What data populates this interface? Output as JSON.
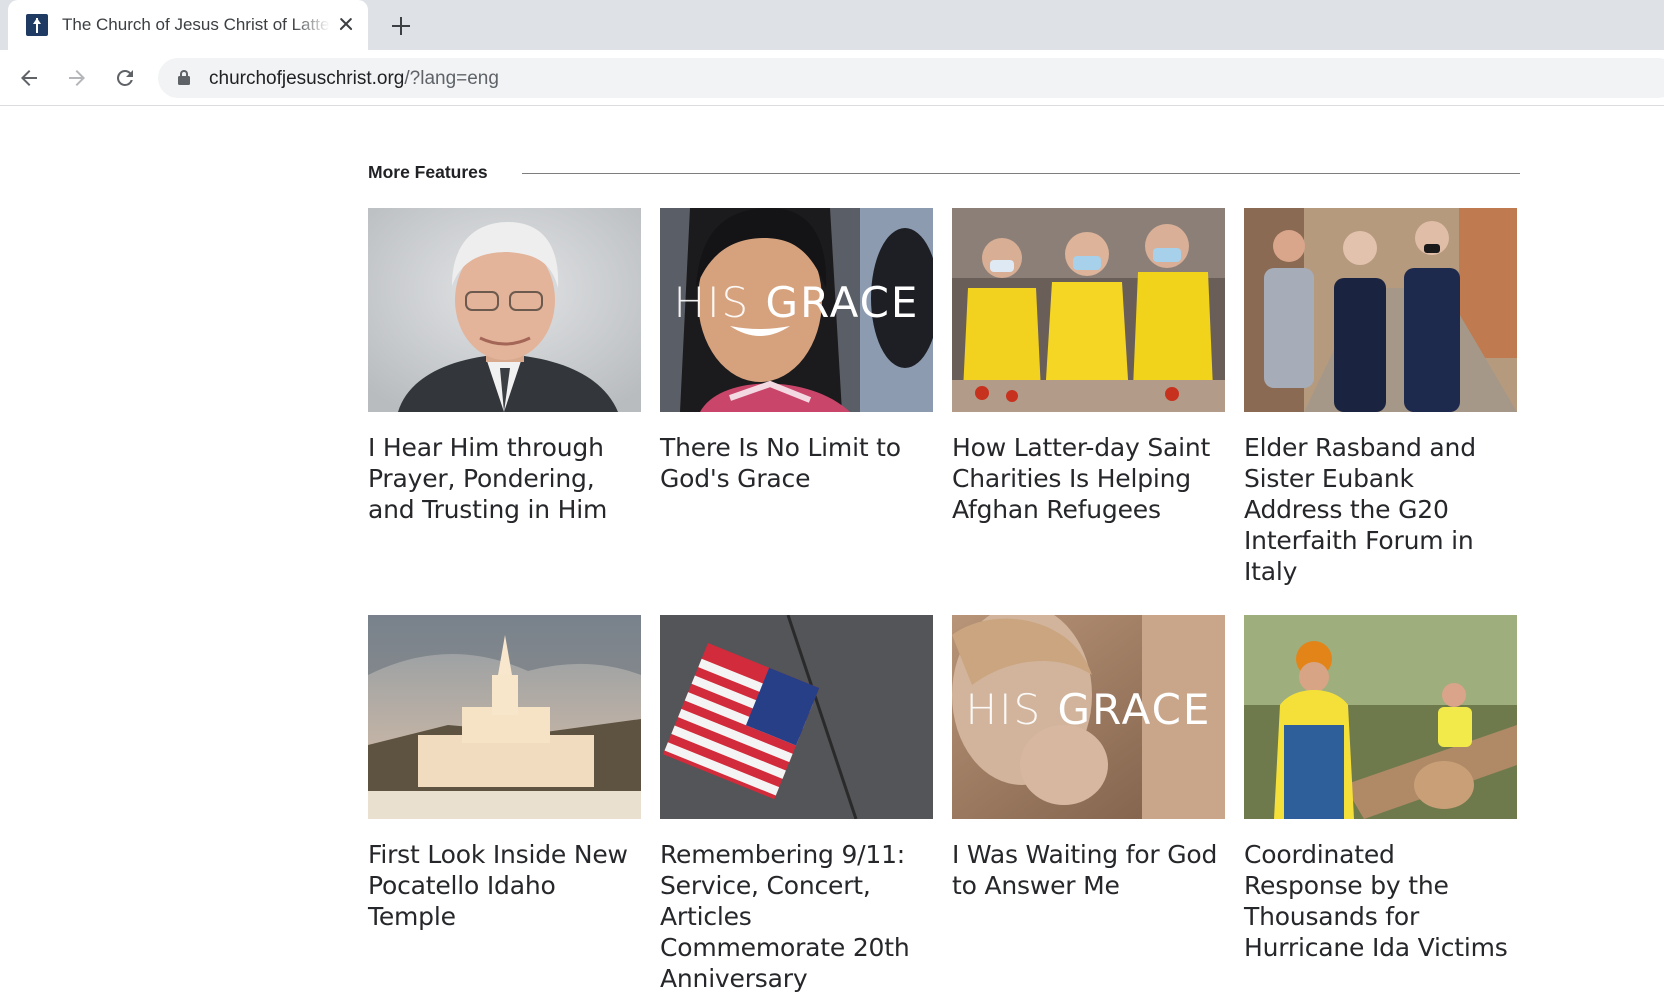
{
  "browser": {
    "tab": {
      "title": "The Church of Jesus Christ of Latter-day Saints",
      "favicon": "church-logo-icon"
    },
    "new_tab_icon": "plus-icon",
    "address_bar": {
      "host": "churchofjesuschrist.org",
      "path": "/?lang=eng"
    },
    "icons": [
      "back-arrow-icon",
      "forward-arrow-icon",
      "reload-icon",
      "lock-icon",
      "close-icon"
    ]
  },
  "section": {
    "title": "More Features",
    "cards": [
      {
        "title": "I Hear Him through Prayer, Pondering, and Trusting in Him"
      },
      {
        "title": "There Is No Limit to God's Grace",
        "overlay": {
          "his": "HIS",
          "grace": "GRACE"
        }
      },
      {
        "title": "How Latter-day Saint Charities Is Helping Afghan Refugees"
      },
      {
        "title": "Elder Rasband and Sister Eubank Address the G20 Interfaith Forum in Italy"
      },
      {
        "title": "First Look Inside New Pocatello Idaho Temple"
      },
      {
        "title": "Remembering 9/11: Service, Concert, Articles Commemorate 20th Anniversary"
      },
      {
        "title": "I Was Waiting for God to Answer Me",
        "overlay": {
          "his": "HIS",
          "grace": "GRACE"
        }
      },
      {
        "title": "Coordinated Response by the Thousands for Hurricane Ida Victims"
      }
    ]
  },
  "colors": {
    "tabstrip": "#dee1e6",
    "omnibox": "#f1f3f4",
    "text": "#212225",
    "rule": "#7d7e80"
  }
}
